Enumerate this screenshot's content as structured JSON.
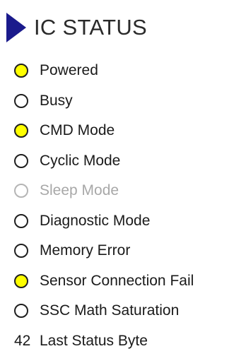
{
  "header": {
    "title": "IC STATUS"
  },
  "status_items": [
    {
      "label": "Powered",
      "state": "on"
    },
    {
      "label": "Busy",
      "state": "off"
    },
    {
      "label": "CMD Mode",
      "state": "on"
    },
    {
      "label": "Cyclic Mode",
      "state": "off"
    },
    {
      "label": "Sleep Mode",
      "state": "disabled"
    },
    {
      "label": "Diagnostic Mode",
      "state": "off"
    },
    {
      "label": "Memory Error",
      "state": "off"
    },
    {
      "label": "Sensor Connection Fail",
      "state": "on"
    },
    {
      "label": "SSC Math Saturation",
      "state": "off"
    }
  ],
  "last_status": {
    "value": "42",
    "label": "Last Status Byte"
  },
  "colors": {
    "indicator_on": "#ffff00",
    "indicator_off": "#ffffff",
    "triangle": "#1a1a8c",
    "disabled_text": "#a8a8a8"
  }
}
